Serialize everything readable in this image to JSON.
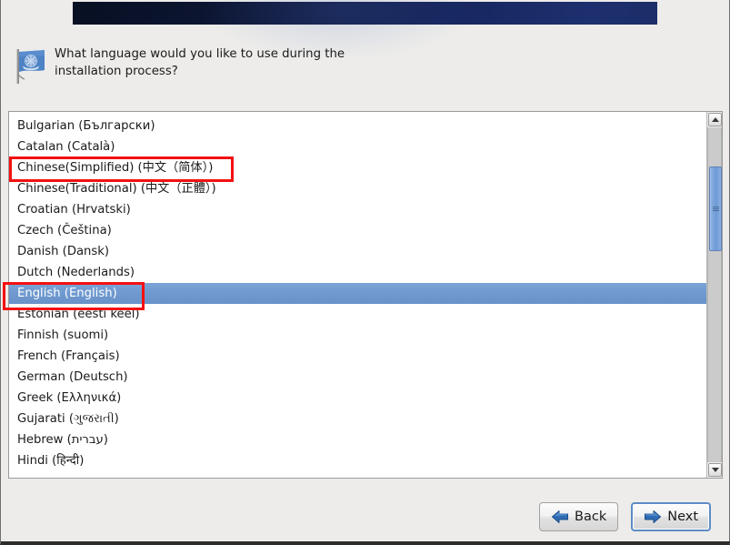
{
  "window": {
    "banner_color_left": "#070f22",
    "banner_color_right": "#1d2f6e",
    "background_color": "#edecea"
  },
  "prompt": {
    "icon": "un-flag-icon",
    "text": "What language would you like to use during the\ninstallation process?"
  },
  "language_list": {
    "selected": "English (English)",
    "items": [
      {
        "label": "Bulgarian (Български)",
        "selected": false,
        "highlighted": false
      },
      {
        "label": "Catalan (Català)",
        "selected": false,
        "highlighted": false
      },
      {
        "label": "Chinese(Simplified) (中文（简体）)",
        "selected": false,
        "highlighted": true
      },
      {
        "label": "Chinese(Traditional) (中文（正體）)",
        "selected": false,
        "highlighted": false
      },
      {
        "label": "Croatian (Hrvatski)",
        "selected": false,
        "highlighted": false
      },
      {
        "label": "Czech (Čeština)",
        "selected": false,
        "highlighted": false
      },
      {
        "label": "Danish (Dansk)",
        "selected": false,
        "highlighted": false
      },
      {
        "label": "Dutch (Nederlands)",
        "selected": false,
        "highlighted": false
      },
      {
        "label": "English (English)",
        "selected": true,
        "highlighted": true
      },
      {
        "label": "Estonian (eesti keel)",
        "selected": false,
        "highlighted": false
      },
      {
        "label": "Finnish (suomi)",
        "selected": false,
        "highlighted": false
      },
      {
        "label": "French (Français)",
        "selected": false,
        "highlighted": false
      },
      {
        "label": "German (Deutsch)",
        "selected": false,
        "highlighted": false
      },
      {
        "label": "Greek (Ελληνικά)",
        "selected": false,
        "highlighted": false
      },
      {
        "label": "Gujarati (ગુજરાતી)",
        "selected": false,
        "highlighted": false
      },
      {
        "label": "Hebrew (עברית)",
        "selected": false,
        "highlighted": false
      },
      {
        "label": "Hindi (हिन्दी)",
        "selected": false,
        "highlighted": false
      }
    ]
  },
  "scrollbar": {
    "up_icon": "chevron-up-icon",
    "down_icon": "chevron-down-icon",
    "thumb_top_pct": 11,
    "thumb_height_pct": 25
  },
  "annotations": {
    "box_color": "#f41010",
    "boxes": [
      {
        "target": "Chinese(Simplified) (中文（简体）)"
      },
      {
        "target": "English (English)"
      }
    ]
  },
  "buttons": {
    "back": {
      "label": "Back",
      "icon": "arrow-left-icon",
      "focused": false
    },
    "next": {
      "label": "Next",
      "icon": "arrow-right-icon",
      "focused": true
    }
  }
}
